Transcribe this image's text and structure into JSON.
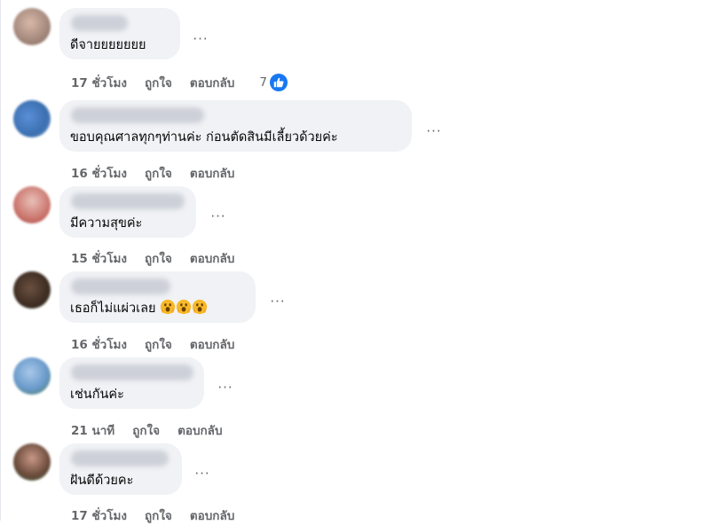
{
  "comments": [
    {
      "text": "ดีจายยยยยยย",
      "time": "17 ชั่วโมง",
      "like": "ถูกใจ",
      "reply": "ตอบกลับ",
      "reactions": "7"
    },
    {
      "text": "ขอบคุณศาลทุกๆท่านค่ะ ก่อนตัดสินมีเลี้ยวด้วยค่ะ",
      "time": "16 ชั่วโมง",
      "like": "ถูกใจ",
      "reply": "ตอบกลับ"
    },
    {
      "text": "มีความสุขค่ะ",
      "time": "15 ชั่วโมง",
      "like": "ถูกใจ",
      "reply": "ตอบกลับ"
    },
    {
      "text": "เธอก็ไม่แผ่วเลย",
      "time": "16 ชั่วโมง",
      "like": "ถูกใจ",
      "reply": "ตอบกลับ"
    },
    {
      "text": "เช่นกันค่ะ",
      "time": "21 นาที",
      "like": "ถูกใจ",
      "reply": "ตอบกลับ"
    },
    {
      "text": "ฝันดีด้วยคะ",
      "time": "17 ชั่วโมง",
      "like": "ถูกใจ",
      "reply": "ตอบกลับ"
    }
  ],
  "more_glyph": "···",
  "icons": {
    "more": "more-options-icon",
    "like_reaction": "thumbs-up-icon",
    "emoji": "surprised-face-emoji"
  },
  "colors": {
    "bubble": "#f0f2f5",
    "meta": "#65676b",
    "like_blue": "#1877f2"
  }
}
